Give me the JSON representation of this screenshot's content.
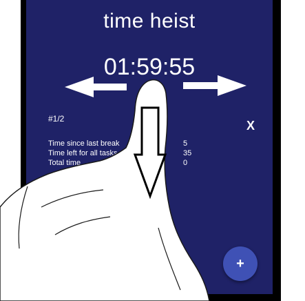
{
  "app": {
    "title": "time heist",
    "timer": "01:59:55"
  },
  "task": {
    "counter": "#1/2",
    "close_label": "X"
  },
  "stats": [
    {
      "label": "Time since last break",
      "value": "5"
    },
    {
      "label": "Time left for all tasks",
      "value": "35"
    },
    {
      "label": "Total time",
      "value": "0"
    }
  ],
  "fab": {
    "label": "+"
  },
  "colors": {
    "background": "#1f2267",
    "fab": "#3f51b5",
    "text": "#ffffff"
  }
}
